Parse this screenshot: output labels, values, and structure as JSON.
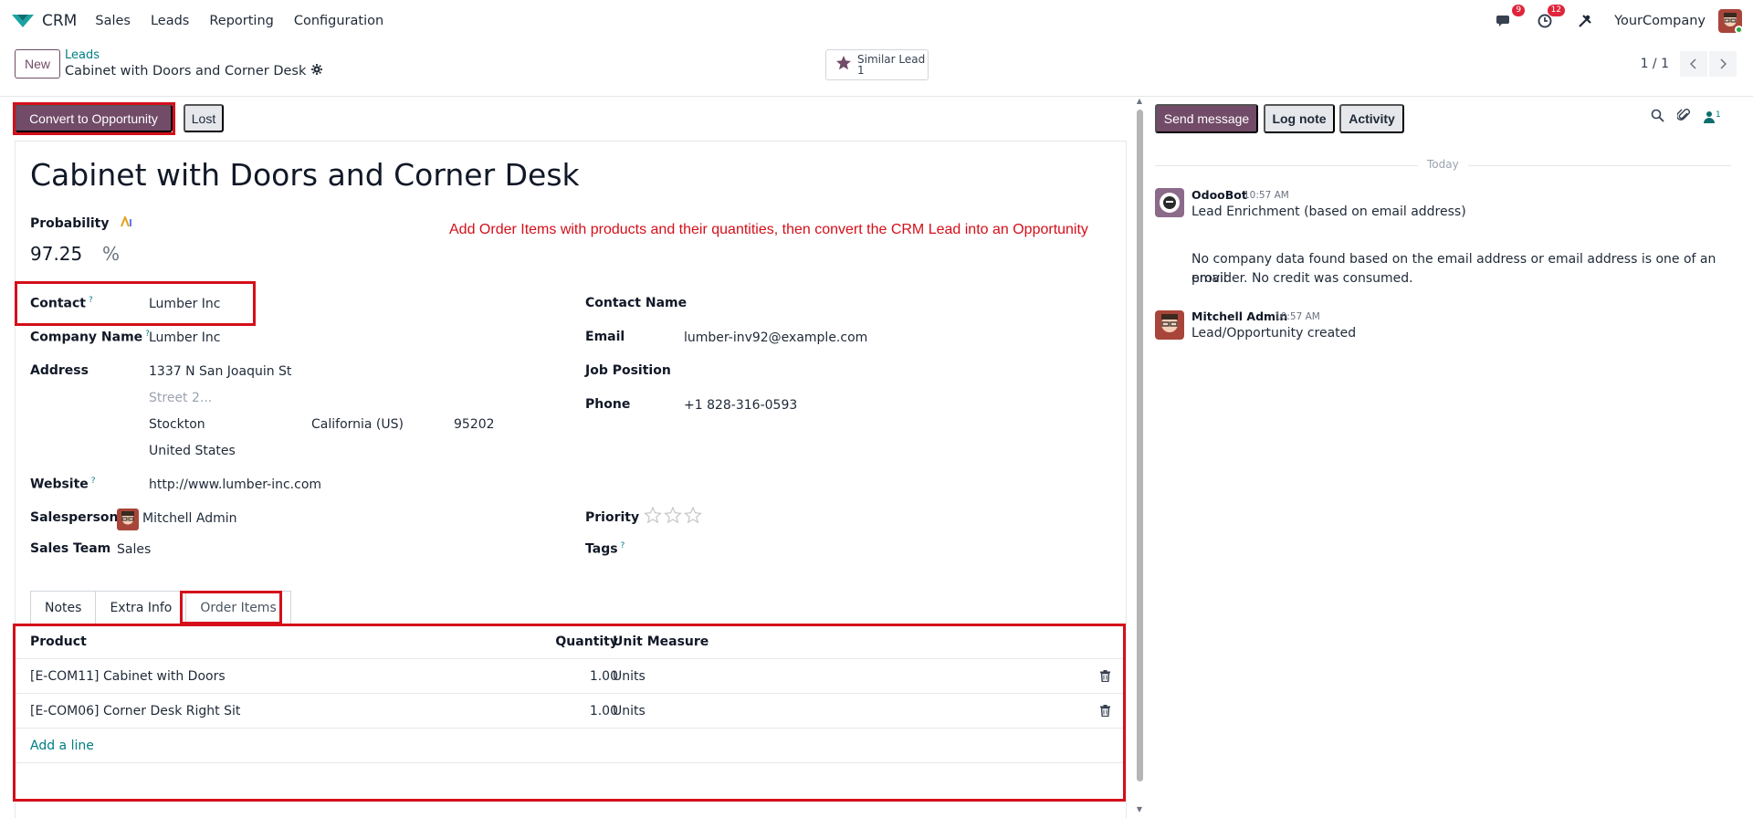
{
  "navbar": {
    "app_name": "CRM",
    "menu": [
      "Sales",
      "Leads",
      "Reporting",
      "Configuration"
    ],
    "messages_count": "9",
    "activities_count": "12",
    "company": "YourCompany"
  },
  "control_panel": {
    "new_label": "New",
    "breadcrumb_parent": "Leads",
    "record_title": "Cabinet with Doors and Corner Desk",
    "similar_lead_label": "Similar Lead",
    "similar_lead_count": "1",
    "pager": "1 / 1"
  },
  "status_bar": {
    "convert_label": "Convert to Opportunity",
    "lost_label": "Lost"
  },
  "form": {
    "title": "Cabinet with Doors and Corner Desk",
    "probability_label": "Probability",
    "probability_value": "97.25",
    "probability_unit": "%",
    "annotation": "Add Order Items with products and their quantities, then convert the CRM Lead into an Opportunity",
    "contact_label": "Contact",
    "contact_value": "Lumber Inc",
    "company_name_label": "Company Name",
    "company_name_value": "Lumber Inc",
    "address_label": "Address",
    "street": "1337 N San Joaquin St",
    "street2_placeholder": "Street 2...",
    "city": "Stockton",
    "state": "California (US)",
    "zip": "95202",
    "country": "United States",
    "website_label": "Website",
    "website_value": "http://www.lumber-inc.com",
    "salesperson_label": "Salesperson",
    "salesperson_value": "Mitchell Admin",
    "sales_team_label": "Sales Team",
    "sales_team_value": "Sales",
    "contact_name_label": "Contact Name",
    "email_label": "Email",
    "email_value": "lumber-inv92@example.com",
    "job_position_label": "Job Position",
    "phone_label": "Phone",
    "phone_value": "+1 828-316-0593",
    "priority_label": "Priority",
    "priority_stars": 0,
    "tags_label": "Tags",
    "tooltip_mark": "?"
  },
  "tabs": [
    "Notes",
    "Extra Info",
    "Order Items"
  ],
  "active_tab": "Order Items",
  "order_items": {
    "headers": {
      "product": "Product",
      "quantity": "Quantity",
      "uom": "Unit Measure"
    },
    "rows": [
      {
        "product": "[E-COM11] Cabinet with Doors",
        "quantity": "1.00",
        "uom": "Units"
      },
      {
        "product": "[E-COM06] Corner Desk Right Sit",
        "quantity": "1.00",
        "uom": "Units"
      }
    ],
    "add_line_label": "Add a line"
  },
  "chatter": {
    "send_message_label": "Send message",
    "log_note_label": "Log note",
    "activity_label": "Activity",
    "followers_count": "1",
    "today_label": "Today",
    "messages": [
      {
        "author": "OdooBot",
        "time": "10:57 AM",
        "line1": "Lead Enrichment (based on email address)",
        "line2": "No company data found based on the email address or email address is one of an email",
        "line3": "provider. No credit was consumed."
      },
      {
        "author": "Mitchell Admin",
        "time": "10:57 AM",
        "line1": "Lead/Opportunity created"
      }
    ]
  },
  "colors": {
    "brand": "#714b67",
    "link": "#017e84",
    "highlight": "#d40f1a"
  }
}
